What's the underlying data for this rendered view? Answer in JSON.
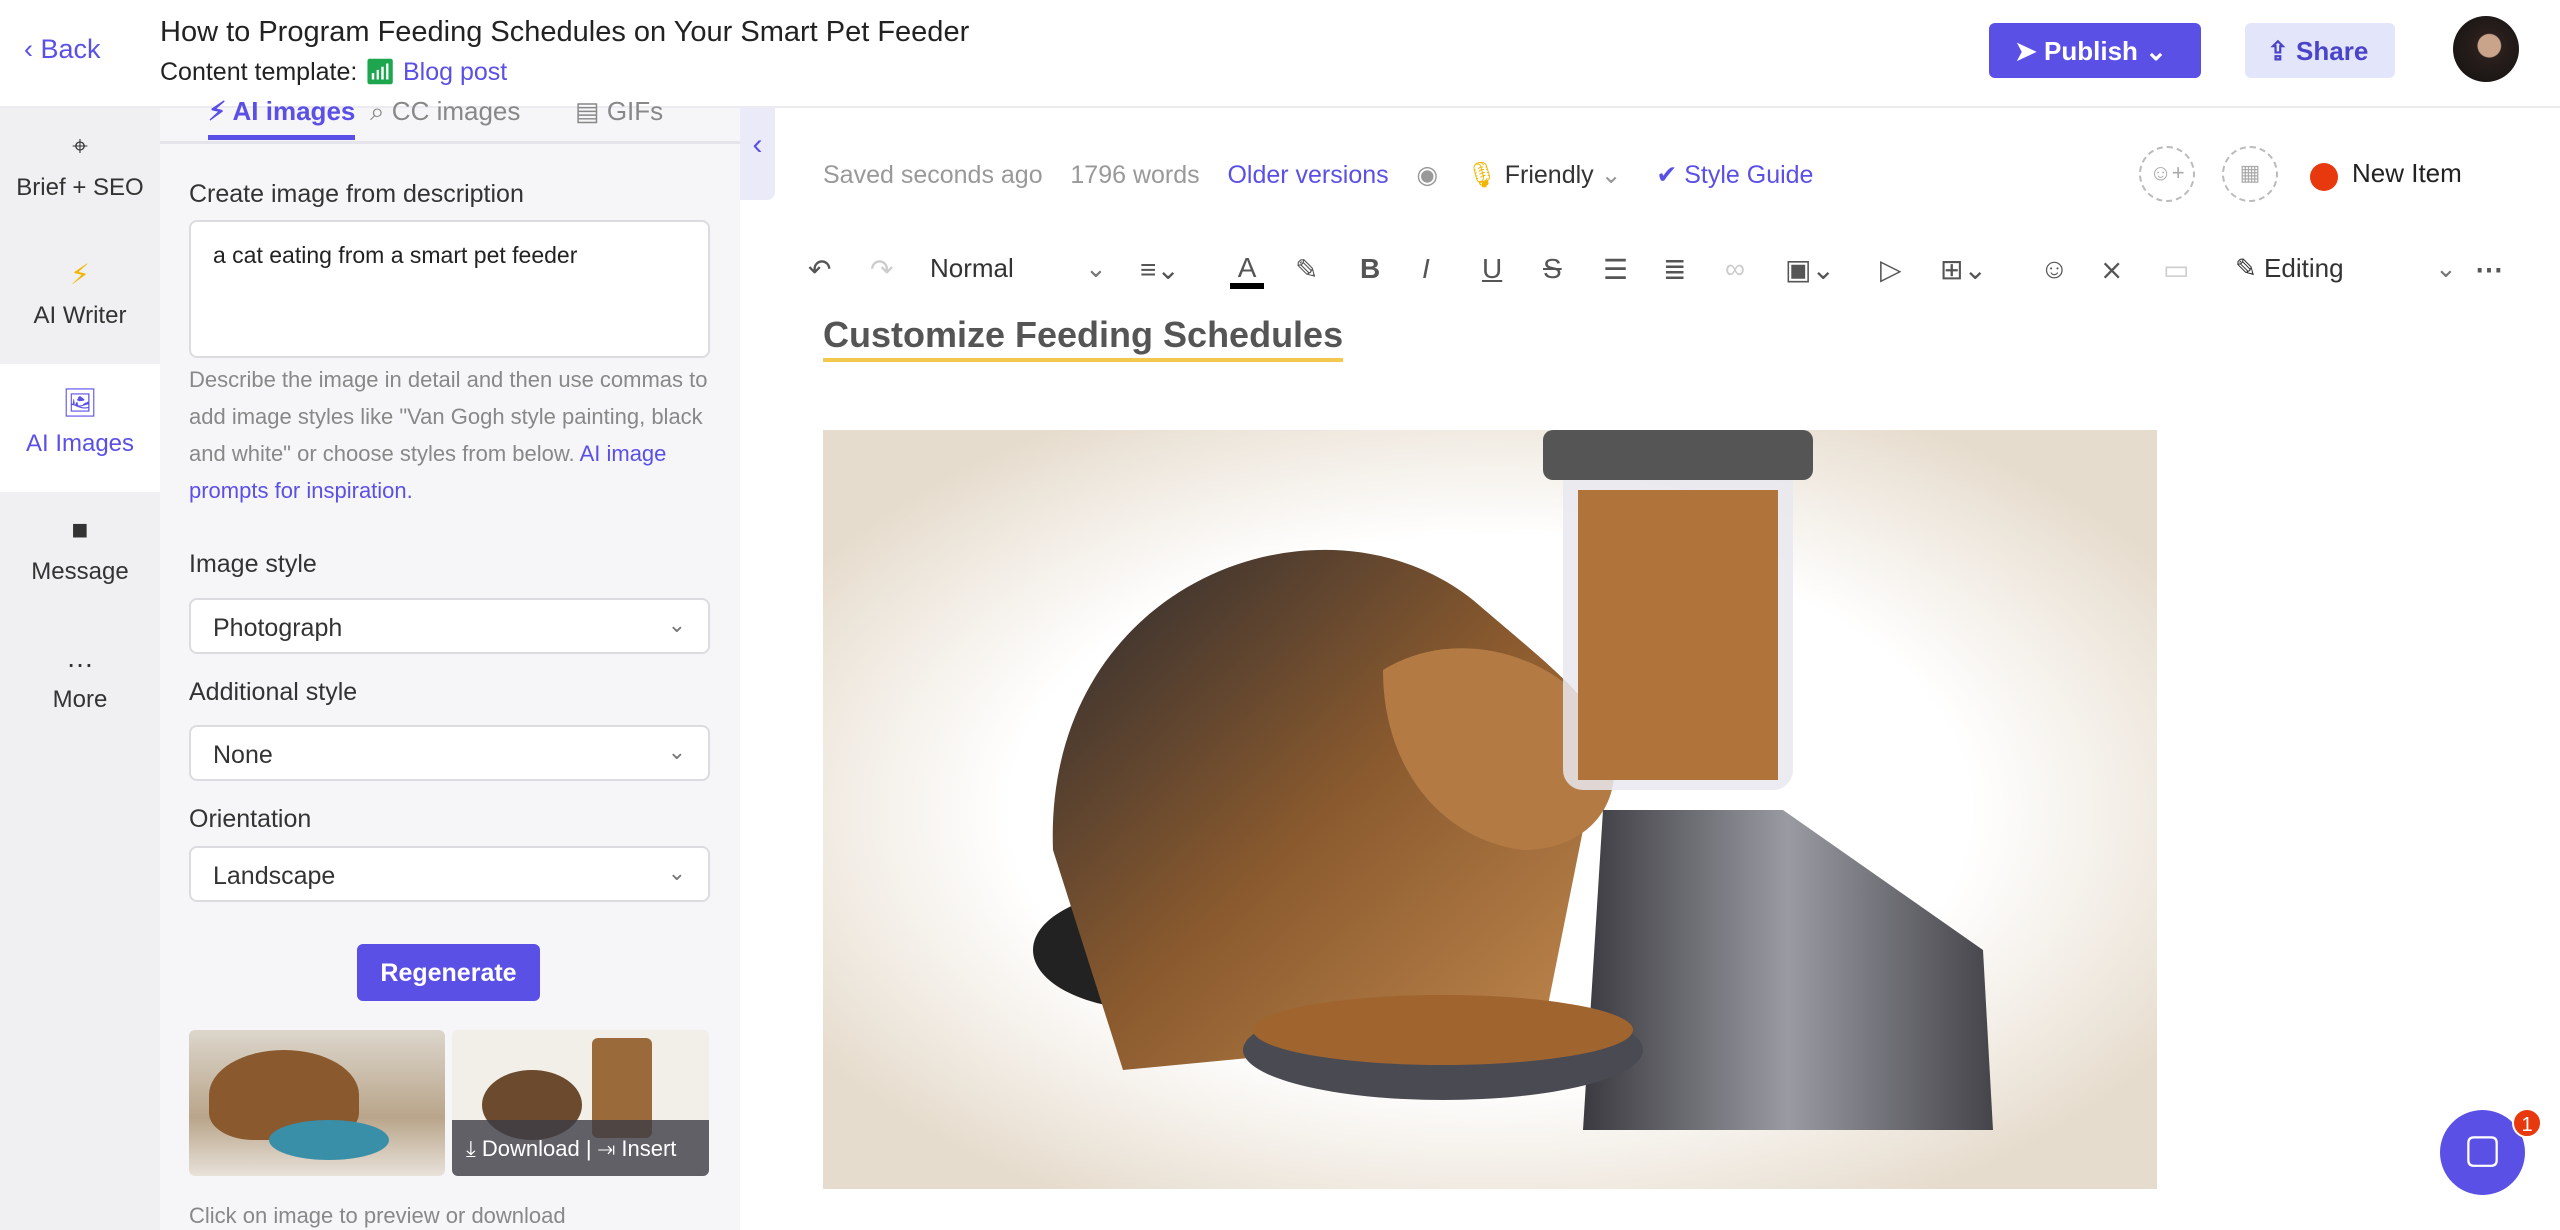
{
  "header": {
    "back_label": "Back",
    "title": "How to Program Feeding Schedules on Your Smart Pet Feeder",
    "template_label": "Content template:",
    "template_value": "Blog post",
    "publish_label": "Publish",
    "share_label": "Share"
  },
  "nav": {
    "items": [
      {
        "label": "Brief + SEO",
        "icon": "crosshair-icon"
      },
      {
        "label": "AI Writer",
        "icon": "lightning-icon"
      },
      {
        "label": "AI Images",
        "icon": "image-icon",
        "active": true
      },
      {
        "label": "Message",
        "icon": "message-icon"
      },
      {
        "label": "More",
        "icon": "more-icon"
      }
    ]
  },
  "panel": {
    "tabs": [
      {
        "label": "AI images",
        "active": true
      },
      {
        "label": "CC images"
      },
      {
        "label": "GIFs"
      }
    ],
    "create_label": "Create image from description",
    "prompt_value": "a cat eating from a smart pet feeder",
    "help_text": "Describe the image in detail and then use commas to add image styles like \"Van Gogh style painting, black and white\" or choose styles from below.",
    "help_link": "AI image prompts for inspiration.",
    "image_style_label": "Image style",
    "image_style_value": "Photograph",
    "additional_style_label": "Additional style",
    "additional_style_value": "None",
    "orientation_label": "Orientation",
    "orientation_value": "Landscape",
    "regenerate_label": "Regenerate",
    "download_label": "Download",
    "insert_label": "Insert",
    "footer_text": "Click on image to preview or download"
  },
  "editor": {
    "saved": "Saved seconds ago",
    "words": "1796 words",
    "older_versions": "Older versions",
    "tone": "Friendly",
    "style_guide": "Style Guide",
    "new_item": "New Item",
    "format_value": "Normal",
    "mode_value": "Editing",
    "heading": "Customize Feeding Schedules"
  },
  "chat": {
    "badge": "1"
  },
  "colors": {
    "accent": "#5b50e6",
    "status_red": "#e8380d",
    "heading_underline": "#f2c94c"
  }
}
